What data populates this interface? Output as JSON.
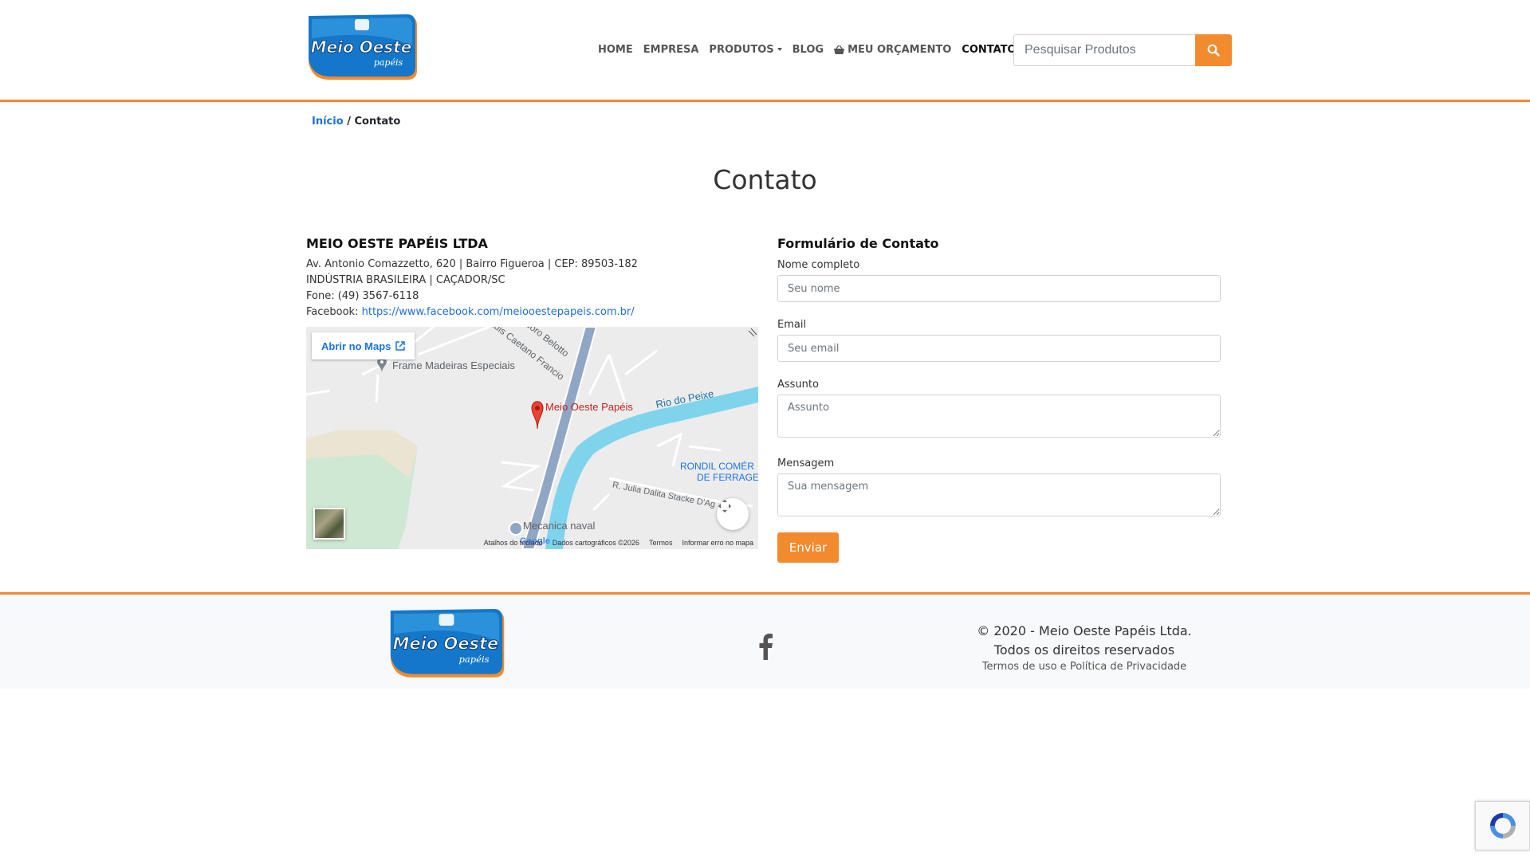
{
  "brand": {
    "logo_main": "Meio Oeste",
    "logo_sub": "papéis",
    "accent_color": "#f28a2e",
    "link_color": "#1e6fd9"
  },
  "nav": {
    "items": [
      {
        "label": "HOME"
      },
      {
        "label": "EMPRESA"
      },
      {
        "label": "PRODUTOS"
      },
      {
        "label": "BLOG"
      },
      {
        "label": "MEU ORÇAMENTO"
      },
      {
        "label": "CONTATO"
      }
    ],
    "search_placeholder": "Pesquisar Produtos"
  },
  "breadcrumb": {
    "home": "Início",
    "separator": "/",
    "current": "Contato"
  },
  "page_title": "Contato",
  "company": {
    "name": "MEIO OESTE PAPÉIS LTDA",
    "address": "Av. Antonio Comazzetto, 620 | Bairro Figueroa | CEP: 89503-182",
    "origin": "INDÚSTRIA BRASILEIRA | CAÇADOR/SC",
    "phone": "Fone: (49) 3567-6118",
    "facebook_label": "Facebook:",
    "facebook_url": "https://www.facebook.com/meiooestepapeis.com.br/"
  },
  "map": {
    "open_button": "Abrir no Maps",
    "labels": {
      "place": "Meio Oeste Papéis",
      "frame": "Frame Madeiras Especiais",
      "river": "Rio do Peixe",
      "street1": "Luis Caetano Francio",
      "street2": "doro Belotto",
      "rondil1": "RONDIL COMÉR",
      "rondil2": "DE FERRAGE",
      "street3": "R. Julia Dalita Stacke D'Ag",
      "naval": "Mecanica naval"
    },
    "google": "Google",
    "footer": {
      "shortcuts": "Atalhos do teclado",
      "data": "Dados cartográficos ©2026",
      "terms": "Termos",
      "report": "Informar erro no mapa"
    }
  },
  "form": {
    "title": "Formulário de Contato",
    "name_label": "Nome completo",
    "name_placeholder": "Seu nome",
    "email_label": "Email",
    "email_placeholder": "Seu email",
    "subject_label": "Assunto",
    "subject_placeholder": "Assunto",
    "message_label": "Mensagem",
    "message_placeholder": "Sua mensagem",
    "submit": "Enviar"
  },
  "footer": {
    "copyright_line1": "© 2020 - Meio Oeste Papéis Ltda.",
    "copyright_line2": "Todos os direitos reservados",
    "terms": "Termos de uso",
    "and": "e",
    "privacy": "Política de Privacidade"
  }
}
